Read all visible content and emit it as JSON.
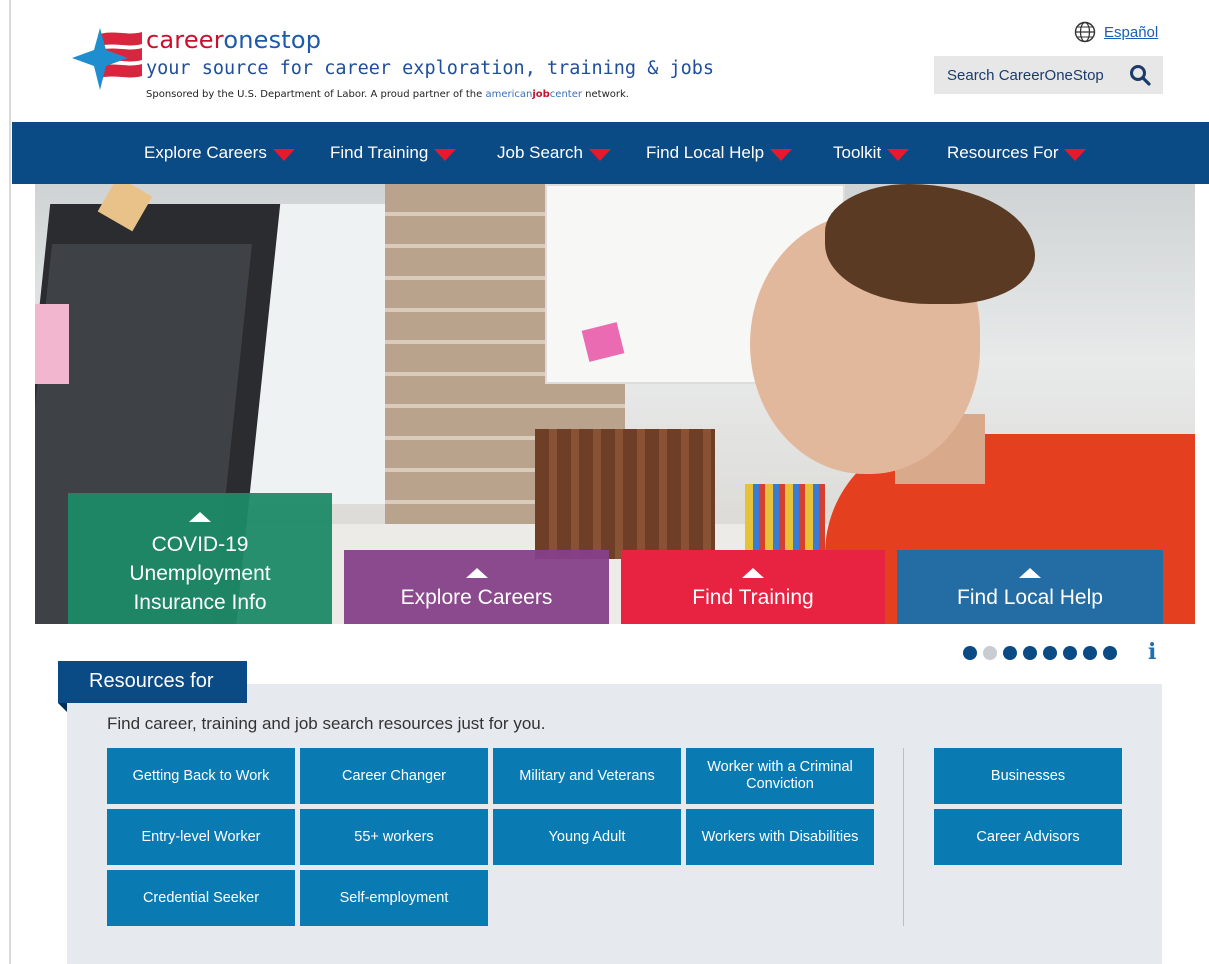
{
  "header": {
    "brand_part1": "career",
    "brand_part2": "onestop",
    "tagline": "your source for career exploration, training & jobs",
    "sponsor_prefix": "Sponsored by the U.S. Department of Labor. A proud partner of the ",
    "ajc_a": "american",
    "ajc_b": "job",
    "ajc_c": "center",
    "sponsor_suffix": " network.",
    "language_link": "Español",
    "search_label": "Search CareerOneStop"
  },
  "nav": {
    "items": [
      {
        "label": "Explore Careers"
      },
      {
        "label": "Find Training"
      },
      {
        "label": "Job Search"
      },
      {
        "label": "Find Local Help"
      },
      {
        "label": "Toolkit"
      },
      {
        "label": "Resources For"
      }
    ]
  },
  "hero": {
    "tiles": [
      {
        "line1": "COVID-19",
        "line2": "Unemployment",
        "line3": "Insurance Info",
        "color": "#1c8a67"
      },
      {
        "label": "Explore Careers",
        "color": "#864089"
      },
      {
        "label": "Find Training",
        "color": "#e82342"
      },
      {
        "label": "Find Local Help",
        "color": "#1870ac"
      }
    ],
    "carousel": {
      "total": 8,
      "active_index": 1,
      "info_label": "i"
    }
  },
  "resources": {
    "tab_label": "Resources for",
    "intro": "Find career, training and job search resources just for you.",
    "buttons": [
      "Getting Back to Work",
      "Career Changer",
      "Military and Veterans",
      "Worker with a Criminal Conviction",
      "Entry-level Worker",
      "55+ workers",
      "Young Adult",
      "Workers with Disabilities",
      "Credential Seeker",
      "Self-employment"
    ],
    "side_buttons": [
      "Businesses",
      "Career Advisors"
    ]
  },
  "colors": {
    "nav_bg": "#0a4a85",
    "accent_red": "#e8192c",
    "button_blue": "#0a7bb2",
    "panel_bg": "#e6eaee"
  }
}
